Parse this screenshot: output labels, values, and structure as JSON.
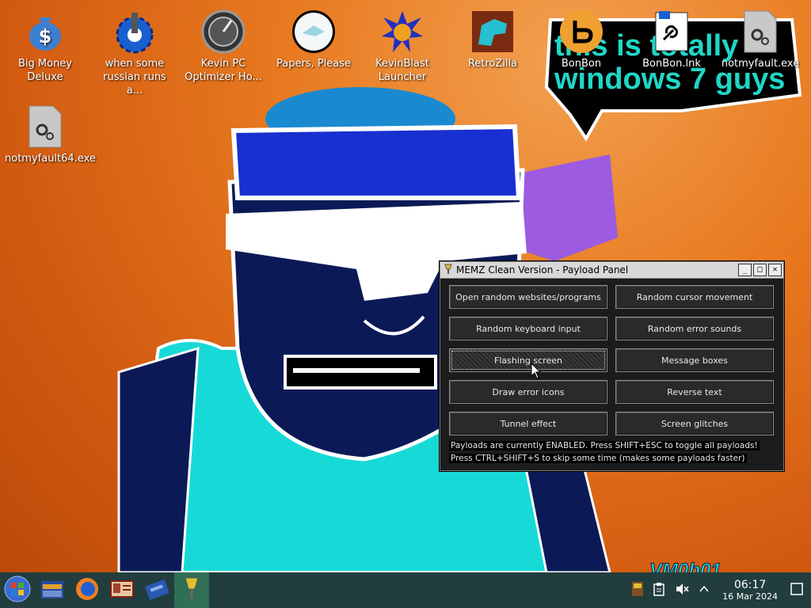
{
  "desktop": {
    "icons": [
      {
        "label": "Big Money Deluxe",
        "icon": "money-bag-icon"
      },
      {
        "label": "when some russian runs a...",
        "icon": "gear-cog-icon"
      },
      {
        "label": "Kevin PC Optimizer Ho...",
        "icon": "speedometer-icon"
      },
      {
        "label": "Papers, Please",
        "icon": "seal-icon"
      },
      {
        "label": "KevinBlast Launcher",
        "icon": "explosion-icon"
      },
      {
        "label": "RetroZilla",
        "icon": "godzilla-icon"
      },
      {
        "label": "BonBon",
        "icon": "bonbon-app-icon"
      },
      {
        "label": "BonBon.lnk",
        "icon": "shortcut-chain-icon"
      },
      {
        "label": "notmyfault.exe",
        "icon": "executable-file-icon"
      },
      {
        "label": "notmyfault64.exe",
        "icon": "executable-file-icon"
      }
    ],
    "wallpaper_text": "this is totally windows 7 guys",
    "wallpaper_signature": "VM0b01"
  },
  "payload_panel": {
    "title": "MEMZ Clean Version - Payload Panel",
    "controls": {
      "minimize": "_",
      "maximize": "□",
      "close": "✕"
    },
    "buttons": [
      "Open random websites/programs",
      "Random cursor movement",
      "Random keyboard input",
      "Random error sounds",
      "Flashing screen",
      "Message boxes",
      "Draw error icons",
      "Reverse text",
      "Tunnel effect",
      "Screen glitches"
    ],
    "active_button": "Flashing screen",
    "status_lines": [
      "Payloads are currently ENABLED. Press SHIFT+ESC to toggle all payloads!",
      "Press CTRL+SHIFT+S to skip some time (makes some payloads faster)"
    ]
  },
  "taskbar": {
    "start_icon": "start-orb-icon",
    "apps": [
      "file-manager-icon",
      "firefox-icon",
      "id-card-icon",
      "disk-utility-icon",
      "memz-icon"
    ],
    "tray": {
      "time": "06:17",
      "date": "16 Mar 2024",
      "icons": [
        "memz-tray-icon",
        "clipboard-icon",
        "mute-icon",
        "chevron-up-icon",
        "show-desktop-icon"
      ]
    }
  },
  "colors": {
    "taskbar_bg": "#223d3e",
    "active_task": "#2f6f55",
    "window_bg": "#1c1c1c",
    "wallpaper_text": "#1fd7c7"
  }
}
